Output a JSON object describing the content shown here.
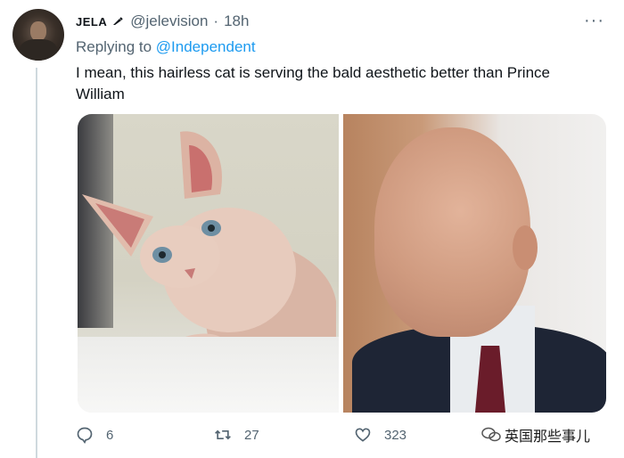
{
  "tweet": {
    "author_name": "JELA",
    "author_handle": "@jelevision",
    "separator": "·",
    "time": "18h",
    "more_label": "···",
    "replying_prefix": "Replying to",
    "replying_to": "@Independent",
    "text": "I mean, this hairless cat is serving the bald aesthetic better than Prince William",
    "media": [
      {
        "subject": "hairless cat photo"
      },
      {
        "subject": "bald man photo"
      }
    ]
  },
  "actions": {
    "reply_count": "6",
    "retweet_count": "27",
    "like_count": "323"
  },
  "watermark": {
    "text": "英国那些事儿"
  },
  "colors": {
    "link": "#1d9bf0",
    "muted": "#536471",
    "text": "#0f1419",
    "thread_line": "#cfd9de"
  },
  "icons": {
    "reply": "comment-icon",
    "retweet": "retweet-icon",
    "like": "heart-icon",
    "more": "more-icon"
  }
}
